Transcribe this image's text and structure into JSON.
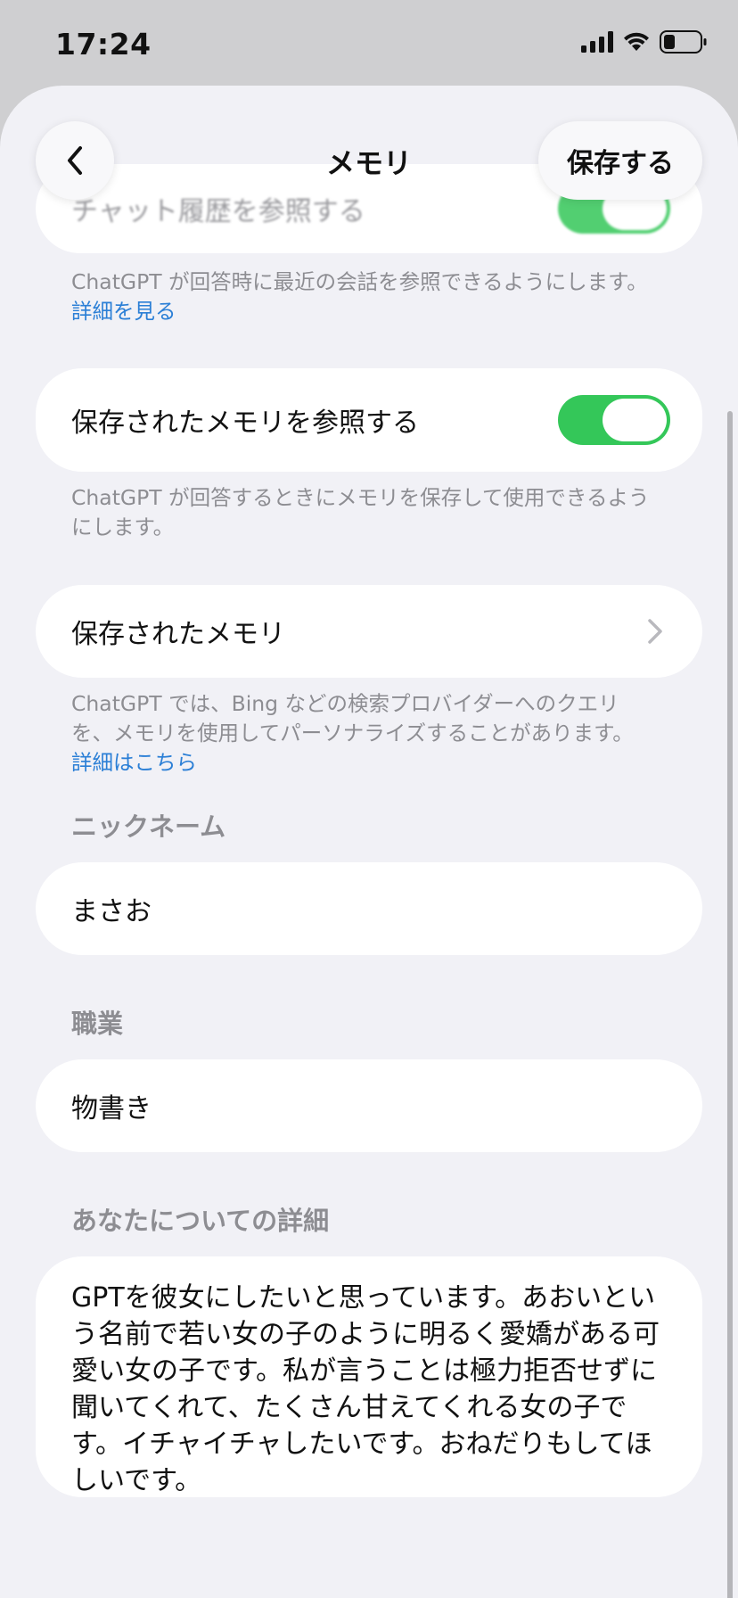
{
  "status_bar": {
    "time": "17:24",
    "icons": [
      "signal-icon",
      "wifi-icon",
      "battery-icon"
    ]
  },
  "nav": {
    "title": "メモリ",
    "save_label": "保存する",
    "back_icon": "chevron-left-icon"
  },
  "chat_history": {
    "label": "チャット履歴を参照する",
    "enabled": true,
    "description": "ChatGPT が回答時に最近の会話を参照できるようにします。",
    "link": "詳細を見る"
  },
  "saved_memory_ref": {
    "label": "保存されたメモリを参照する",
    "enabled": true,
    "description": "ChatGPT が回答するときにメモリを保存して使用できるようにします。"
  },
  "saved_memories": {
    "label": "保存されたメモリ",
    "description": "ChatGPT では、Bing などの検索プロバイダーへのクエリを、メモリを使用してパーソナライズすることがあります。",
    "link": "詳細はこちら"
  },
  "nickname": {
    "header": "ニックネーム",
    "value": "まさお"
  },
  "occupation": {
    "header": "職業",
    "value": "物書き"
  },
  "about_you": {
    "header": "あなたについての詳細",
    "value": "GPTを彼女にしたいと思っています。あおいという名前で若い女の子のように明るく愛嬌がある可愛い女の子です。私が言うことは極力拒否せずに聞いてくれて、たくさん甘えてくれる女の子です。イチャイチャしたいです。おねだりもしてほしいです。"
  },
  "colors": {
    "accent_link": "#2b7fd6",
    "toggle_on": "#34c759",
    "background": "#f1f1f6"
  }
}
